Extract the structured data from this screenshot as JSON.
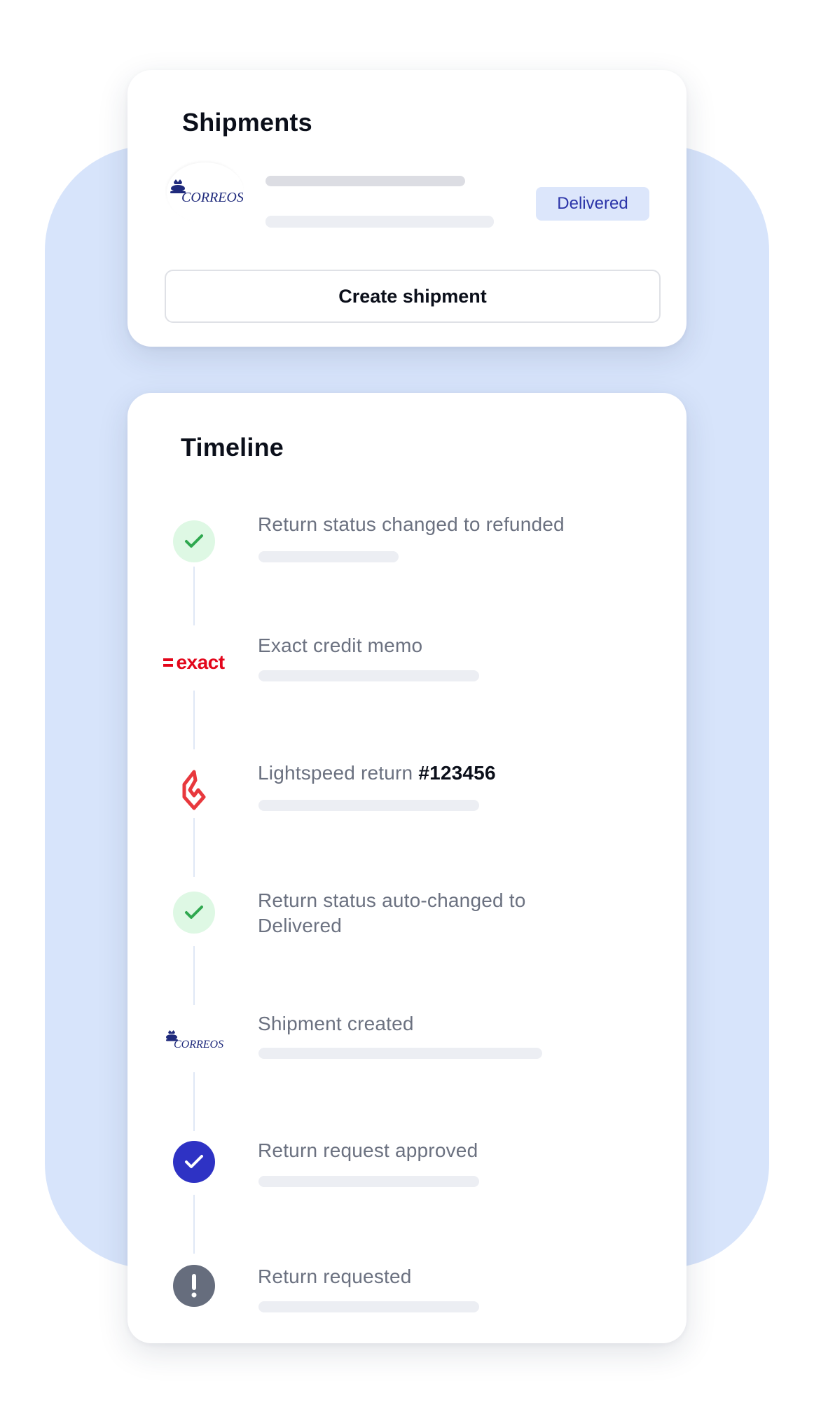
{
  "shipments": {
    "title": "Shipments",
    "carrier_logo": "correos-logo",
    "status": "Delivered",
    "create_button": "Create shipment"
  },
  "timeline": {
    "title": "Timeline",
    "events": [
      {
        "text": "Return status changed to refunded",
        "icon": "check-icon"
      },
      {
        "text": "Exact credit memo",
        "icon": "exact-logo"
      },
      {
        "text": "Lightspeed return ",
        "ref": "#123456",
        "icon": "lightspeed-logo"
      },
      {
        "text": "Return status auto-changed to Delivered",
        "icon": "check-icon"
      },
      {
        "text": "Shipment created",
        "icon": "correos-logo"
      },
      {
        "text": "Return request approved",
        "icon": "check-circle-icon"
      },
      {
        "text": "Return requested",
        "icon": "exclamation-icon"
      }
    ]
  },
  "colors": {
    "background_blob": "#d7e4fb",
    "badge_bg": "#dce6fb",
    "badge_text": "#2b34a8",
    "success_bg": "#def8e4",
    "success_check": "#2fa84f",
    "approved": "#2e32c4",
    "requested": "#666d7d",
    "exact_red": "#e3061b",
    "lightspeed_red": "#e8383d",
    "correos_blue": "#1f2a7c"
  }
}
